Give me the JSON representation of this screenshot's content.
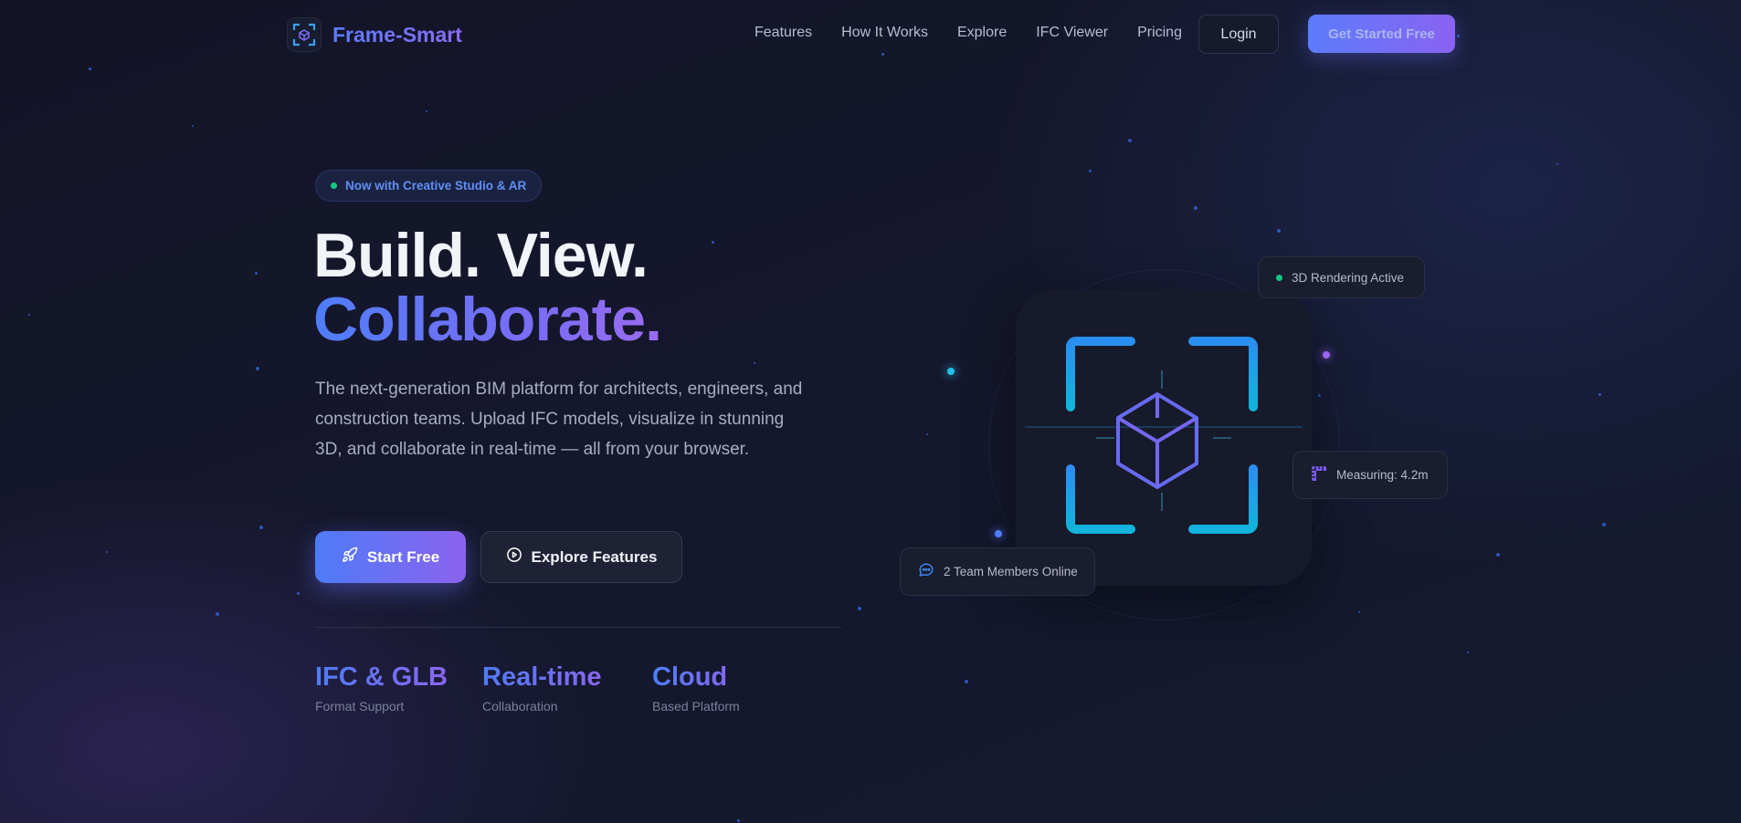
{
  "brand": {
    "name": "Frame-Smart"
  },
  "nav": {
    "links": [
      "Features",
      "How It Works",
      "Explore",
      "IFC Viewer",
      "Pricing"
    ],
    "login_label": "Login",
    "cta_label": "Get Started Free"
  },
  "hero": {
    "badge": "Now with Creative Studio & AR",
    "headline_line1": "Build. View.",
    "headline_line2": "Collaborate.",
    "description": "The next-generation BIM platform for architects, engineers, and construction teams. Upload IFC models, visualize in stunning 3D, and collaborate in real-time — all from your browser.",
    "primary_button": "Start Free",
    "secondary_button": "Explore Features",
    "stats": [
      {
        "value": "IFC & GLB",
        "label": "Format Support"
      },
      {
        "value": "Real-time",
        "label": "Collaboration"
      },
      {
        "value": "Cloud",
        "label": "Based Platform"
      }
    ]
  },
  "visual": {
    "rendering_status": "3D Rendering Active",
    "measuring_label": "Measuring: 4.2m",
    "team_label": "2 Team Members Online"
  },
  "colors": {
    "accent_blue": "#4f7df8",
    "accent_purple": "#8a63f1",
    "status_green": "#16c784",
    "background": "#14162a"
  }
}
